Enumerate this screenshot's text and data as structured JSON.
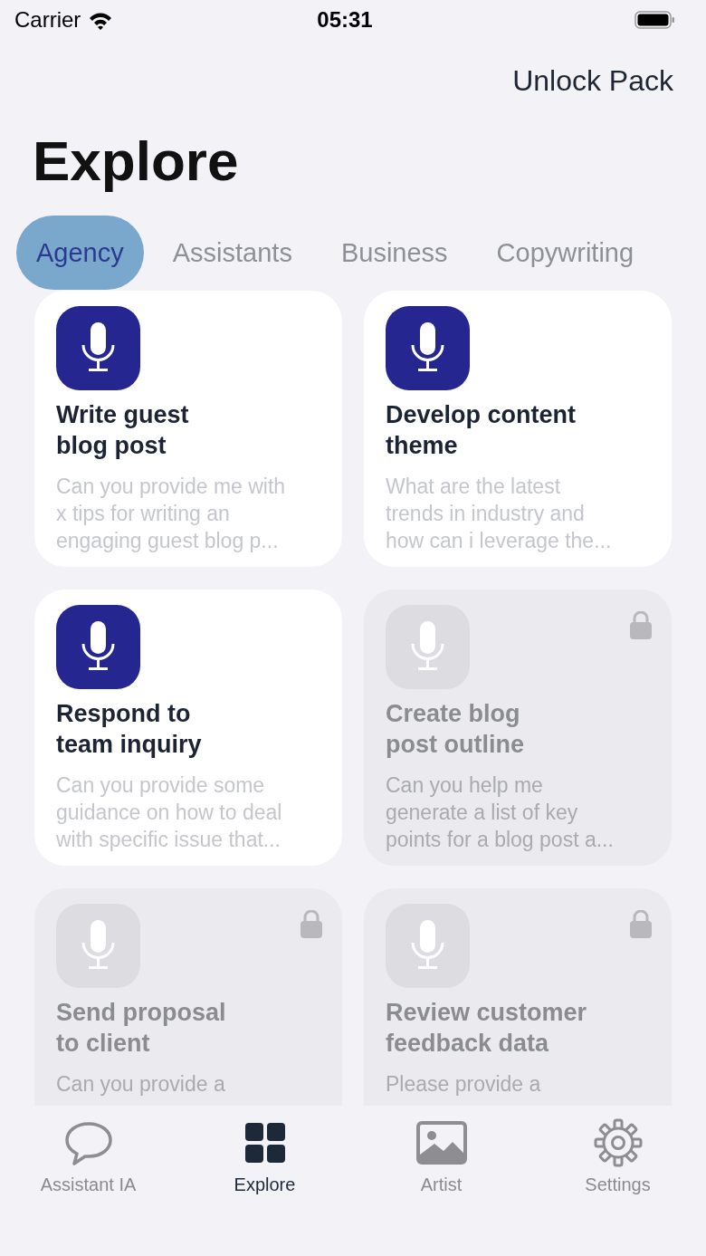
{
  "status_bar": {
    "carrier": "Carrier",
    "time": "05:31"
  },
  "header": {
    "action": "Unlock Pack",
    "title": "Explore"
  },
  "categories": [
    {
      "label": "Agency",
      "selected": true
    },
    {
      "label": "Assistants",
      "selected": false
    },
    {
      "label": "Business",
      "selected": false
    },
    {
      "label": "Copywriting",
      "selected": false
    }
  ],
  "prompts": [
    {
      "title": "Write guest\nblog post",
      "description": "Can you provide me with\nx tips for writing an\nengaging guest blog p...",
      "locked": false
    },
    {
      "title": "Develop content\ntheme",
      "description": "What are the latest\ntrends in industry and\nhow can i leverage the...",
      "locked": false
    },
    {
      "title": "Respond to\nteam inquiry",
      "description": "Can you provide some\nguidance on how to deal\nwith specific issue that...",
      "locked": false
    },
    {
      "title": "Create blog\npost outline",
      "description": "Can you help me\ngenerate a list of key\npoints for a blog post a...",
      "locked": true
    },
    {
      "title": "Send proposal\nto client",
      "description": "Can you provide a",
      "locked": true
    },
    {
      "title": "Review customer\nfeedback data",
      "description": "Please provide a",
      "locked": true
    }
  ],
  "tab_bar": [
    {
      "kind": "chat",
      "label": "Assistant IA",
      "selected": false
    },
    {
      "kind": "grid",
      "label": "Explore",
      "selected": true
    },
    {
      "kind": "image",
      "label": "Artist",
      "selected": false
    },
    {
      "kind": "gear",
      "label": "Settings",
      "selected": false
    }
  ]
}
